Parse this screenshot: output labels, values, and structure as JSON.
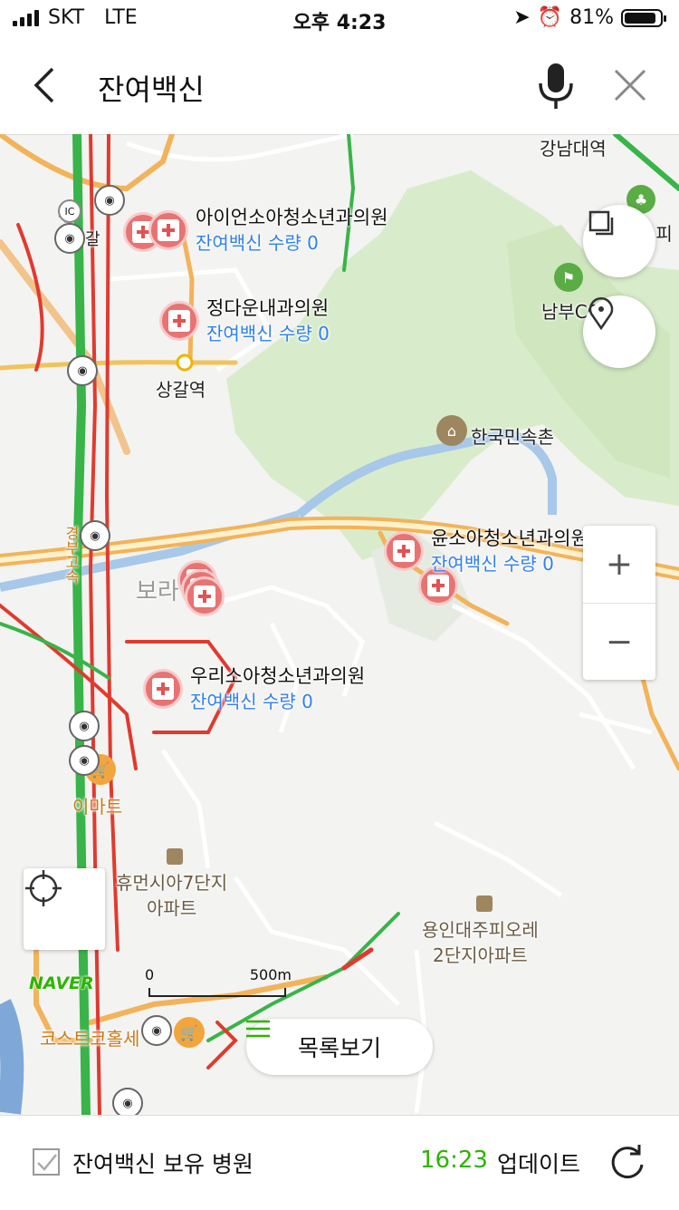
{
  "status": {
    "carrier": "SKT",
    "network": "LTE",
    "time": "오후 4:23",
    "battery": "81%"
  },
  "search": {
    "query": "잔여백신"
  },
  "map": {
    "places": {
      "gangnam_station": "강남대역",
      "sanggal_station": "상갈역",
      "folk_village": "한국민속촌",
      "nambu_cc": "남부CC",
      "emart": "이마트",
      "humansia": "휴먼시아7단지\n아파트",
      "yongin": "용인대주피오레\n2단지아파트",
      "costco": "코스트코홀세",
      "bora": "보라",
      "ic": "IC",
      "gyeongbu": "경부고속",
      "suji": "수",
      "gal": "갈",
      "sopi": "소피"
    },
    "hospitals": [
      {
        "name": "아이언소아청소년과의원",
        "stock": "잔여백신 수량 0"
      },
      {
        "name": "정다운내과의원",
        "stock": "잔여백신 수량 0"
      },
      {
        "name": "윤소아청소년과의원",
        "stock": "잔여백신 수량 0"
      },
      {
        "name": "우리소아청소년과의원",
        "stock": "잔여백신 수량 0"
      }
    ],
    "scale": {
      "start": "0",
      "end": "500m"
    },
    "logo": "NAVER",
    "zoom_in": "+",
    "zoom_out": "−",
    "list_button": "목록보기"
  },
  "bottom": {
    "filter_label": "잔여백신 보유 병원",
    "update_time": "16:23",
    "update_label": "업데이트"
  }
}
